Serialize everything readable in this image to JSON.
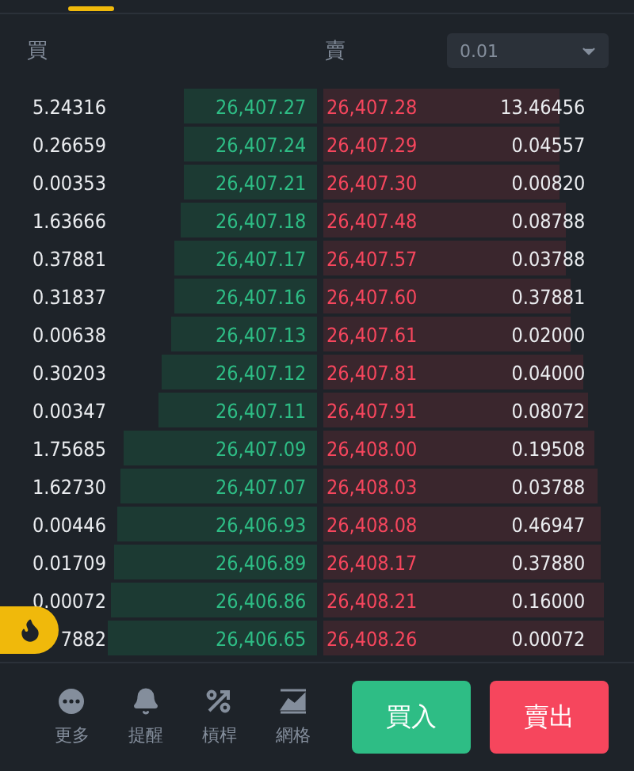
{
  "tabs": [
    {
      "selected": true
    }
  ],
  "header": {
    "bid_label": "買",
    "ask_label": "賣",
    "precision": {
      "value": "0.01"
    }
  },
  "rows": [
    {
      "bid": {
        "qty": "5.24316",
        "price": "26,407.27"
      },
      "ask": {
        "price": "26,407.28",
        "qty": "13.46456"
      }
    },
    {
      "bid": {
        "qty": "0.26659",
        "price": "26,407.24"
      },
      "ask": {
        "price": "26,407.29",
        "qty": "0.04557"
      }
    },
    {
      "bid": {
        "qty": "0.00353",
        "price": "26,407.21"
      },
      "ask": {
        "price": "26,407.30",
        "qty": "0.00820"
      }
    },
    {
      "bid": {
        "qty": "1.63666",
        "price": "26,407.18"
      },
      "ask": {
        "price": "26,407.48",
        "qty": "0.08788"
      }
    },
    {
      "bid": {
        "qty": "0.37881",
        "price": "26,407.17"
      },
      "ask": {
        "price": "26,407.57",
        "qty": "0.03788"
      }
    },
    {
      "bid": {
        "qty": "0.31837",
        "price": "26,407.16"
      },
      "ask": {
        "price": "26,407.60",
        "qty": "0.37881"
      }
    },
    {
      "bid": {
        "qty": "0.00638",
        "price": "26,407.13"
      },
      "ask": {
        "price": "26,407.61",
        "qty": "0.02000"
      }
    },
    {
      "bid": {
        "qty": "0.30203",
        "price": "26,407.12"
      },
      "ask": {
        "price": "26,407.81",
        "qty": "0.04000"
      }
    },
    {
      "bid": {
        "qty": "0.00347",
        "price": "26,407.11"
      },
      "ask": {
        "price": "26,407.91",
        "qty": "0.08072"
      }
    },
    {
      "bid": {
        "qty": "1.75685",
        "price": "26,407.09"
      },
      "ask": {
        "price": "26,408.00",
        "qty": "0.19508"
      }
    },
    {
      "bid": {
        "qty": "1.62730",
        "price": "26,407.07"
      },
      "ask": {
        "price": "26,408.03",
        "qty": "0.03788"
      }
    },
    {
      "bid": {
        "qty": "0.00446",
        "price": "26,406.93"
      },
      "ask": {
        "price": "26,408.08",
        "qty": "0.46947"
      }
    },
    {
      "bid": {
        "qty": "0.01709",
        "price": "26,406.89"
      },
      "ask": {
        "price": "26,408.17",
        "qty": "0.37880"
      }
    },
    {
      "bid": {
        "qty": "0.00072",
        "price": "26,406.86"
      },
      "ask": {
        "price": "26,408.21",
        "qty": "0.16000"
      }
    },
    {
      "bid": {
        "qty": "7882",
        "price": "26,406.65"
      },
      "ask": {
        "price": "26,408.26",
        "qty": "0.00072"
      }
    }
  ],
  "toolbar": [
    {
      "kind": "more",
      "label": "更多"
    },
    {
      "kind": "alert",
      "label": "提醒"
    },
    {
      "kind": "leverage",
      "label": "槓桿"
    },
    {
      "kind": "grid",
      "label": "網格"
    }
  ],
  "actions": [
    {
      "kind": "buy",
      "label": "買入"
    },
    {
      "kind": "sell",
      "label": "賣出"
    }
  ]
}
